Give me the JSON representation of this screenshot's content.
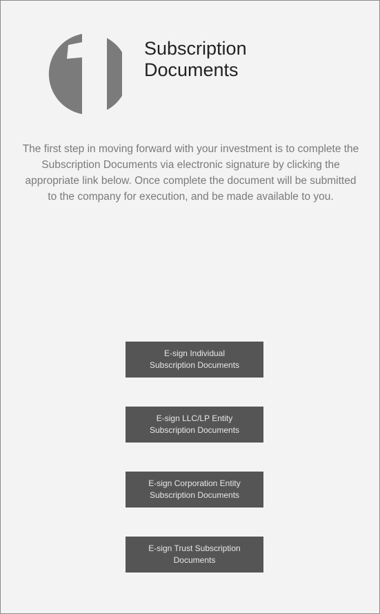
{
  "header": {
    "title_line1": "Subscription",
    "title_line2": "Documents",
    "icon": "step-one-icon",
    "icon_color": "#7b7b7b"
  },
  "intro": {
    "text": "The first step in moving forward with your investment is to complete the Subscription Documents via electronic signature by clicking the appropriate link below. Once complete the document will be submitted to the company for execution, and be made available to you."
  },
  "buttons": [
    {
      "line1": "E-sign Individual",
      "line2": "Subscription Documents"
    },
    {
      "line1": "E-sign LLC/LP Entity",
      "line2": "Subscription Documents"
    },
    {
      "line1": "E-sign Corporation Entity",
      "line2": "Subscription Documents"
    },
    {
      "line1": "E-sign Trust Subscription",
      "line2": "Documents"
    }
  ],
  "colors": {
    "background": "#f3f3f3",
    "button_bg": "#555555",
    "button_text": "#e8e8e8",
    "title_text": "#222222",
    "body_text": "#7a7a7a"
  }
}
